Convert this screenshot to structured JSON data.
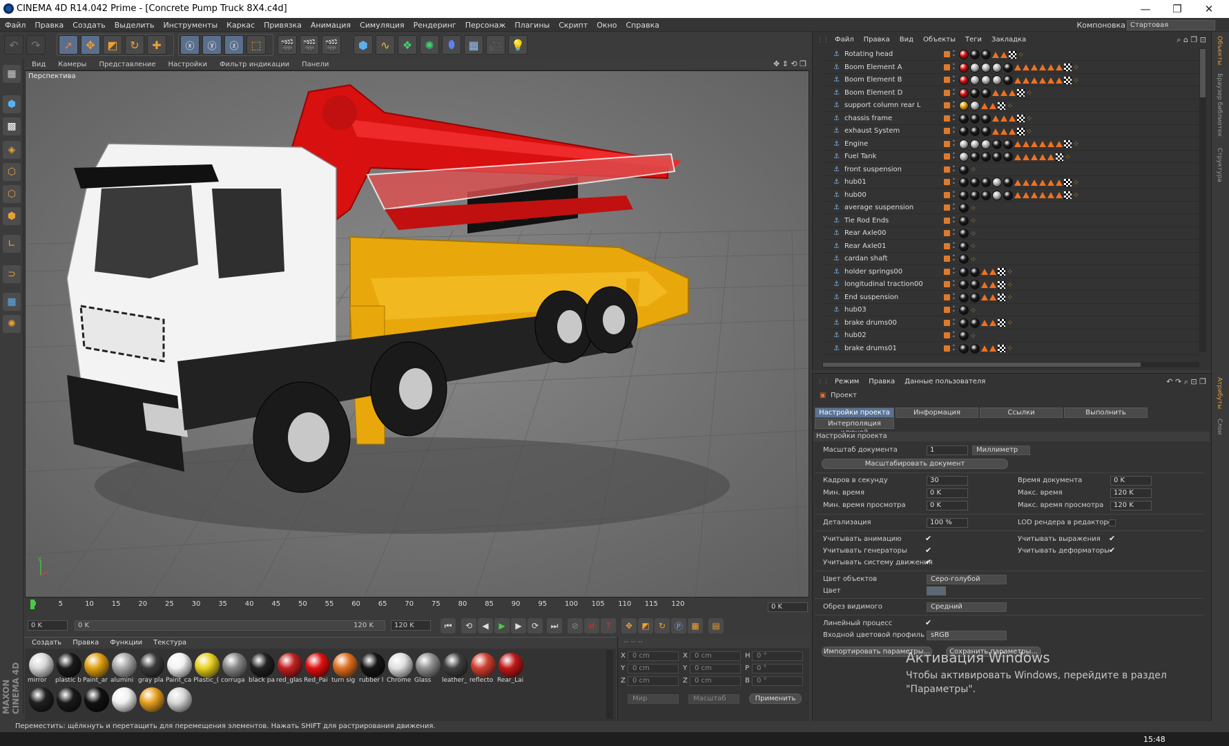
{
  "window": {
    "title": "CINEMA 4D R14.042 Prime - [Concrete Pump Truck 8X4.c4d]"
  },
  "menu": [
    "Файл",
    "Правка",
    "Создать",
    "Выделить",
    "Инструменты",
    "Каркас",
    "Привязка",
    "Анимация",
    "Симуляция",
    "Рендеринг",
    "Персонаж",
    "Плагины",
    "Скрипт",
    "Окно",
    "Справка"
  ],
  "layout": {
    "label": "Компоновка",
    "value": "Стартовая"
  },
  "viewport": {
    "menu": [
      "Вид",
      "Камеры",
      "Представление",
      "Настройки",
      "Фильтр индикации",
      "Панели"
    ],
    "label": "Перспектива"
  },
  "timeline": {
    "ticks": [
      "0",
      "5",
      "10",
      "15",
      "20",
      "25",
      "30",
      "35",
      "40",
      "45",
      "50",
      "55",
      "60",
      "65",
      "70",
      "75",
      "80",
      "85",
      "90",
      "95",
      "100",
      "105",
      "110",
      "115",
      "120"
    ],
    "current_frame": "0 K"
  },
  "playbar": {
    "start": "0 K",
    "range_start": "0 K",
    "range_end": "120 K",
    "end": "120 K"
  },
  "materials": {
    "menu": [
      "Создать",
      "Правка",
      "Функции",
      "Текстура"
    ],
    "items": [
      {
        "label": "mirror",
        "color": "#d8d8d8"
      },
      {
        "label": "plastic b",
        "color": "#1a1a1a"
      },
      {
        "label": "Paint_ar",
        "color": "#e0a010"
      },
      {
        "label": "alumini",
        "color": "#a8a8a8"
      },
      {
        "label": "gray pla",
        "color": "#3a3a3a"
      },
      {
        "label": "Paint_ca",
        "color": "#f2f2f2"
      },
      {
        "label": "Plastic_(",
        "color": "#e8d020"
      },
      {
        "label": "corruga",
        "color": "#888888"
      },
      {
        "label": "black pa",
        "color": "#202020"
      },
      {
        "label": "red_glas",
        "color": "#c02020"
      },
      {
        "label": "Red_Pai",
        "color": "#e01010"
      },
      {
        "label": "turn sig",
        "color": "#e07020"
      },
      {
        "label": "rubber l",
        "color": "#151515"
      },
      {
        "label": "Chrome",
        "color": "#e0e0e0"
      },
      {
        "label": "Glass",
        "color": "#909090"
      },
      {
        "label": "leather_",
        "color": "#404040"
      },
      {
        "label": "reflecto",
        "color": "#d04030"
      },
      {
        "label": "Rear_Lai",
        "color": "#c01818"
      }
    ],
    "row2": [
      {
        "color": "#202020"
      },
      {
        "color": "#1a1a1a"
      },
      {
        "color": "#111111"
      },
      {
        "color": "#f0f0f0"
      },
      {
        "color": "#e8a020"
      },
      {
        "color": "#d8d8d8"
      }
    ]
  },
  "coords": {
    "x1": "0 cm",
    "y1": "0 cm",
    "z1": "0 cm",
    "x2": "0 cm",
    "y2": "0 cm",
    "z2": "0 cm",
    "h": "0 °",
    "p": "0 °",
    "b": "0 °",
    "mode1": "Мир",
    "mode2": "Масштаб",
    "apply": "Применить"
  },
  "status": "Переместить: щёлкнуть и перетащить для перемещения элементов. Нажать SHIFT для растрирования движения.",
  "objects": {
    "menu": [
      "Файл",
      "Правка",
      "Вид",
      "Объекты",
      "Теги",
      "Закладка"
    ],
    "rows": [
      {
        "name": "Rotating head",
        "tags": "rbbTTcs"
      },
      {
        "name": "Boom Element A",
        "tags": "rgggbTTTTTTcs"
      },
      {
        "name": "Boom Element B",
        "tags": "rgggbTTTTTTcs"
      },
      {
        "name": "Boom Element D",
        "tags": "rbbTTTcs"
      },
      {
        "name": "support column rear L",
        "tags": "ygTTcs"
      },
      {
        "name": "chassis frame",
        "tags": "bbbTTTcs"
      },
      {
        "name": "exhaust System",
        "tags": "bbbTTTcs"
      },
      {
        "name": "Engine",
        "tags": "gggbbTTTTTTcs"
      },
      {
        "name": "Fuel Tank",
        "tags": "gbbbbTTTTTcs"
      },
      {
        "name": "front suspension",
        "tags": "bs"
      },
      {
        "name": "hub01",
        "tags": "bbbgbTTTTTTcs"
      },
      {
        "name": "hub00",
        "tags": "bbbgbTTTTTTcs"
      },
      {
        "name": "average suspension",
        "tags": "bs"
      },
      {
        "name": "Tie Rod Ends",
        "tags": "bs"
      },
      {
        "name": "Rear Axle00",
        "tags": "bs"
      },
      {
        "name": "Rear Axle01",
        "tags": "bs"
      },
      {
        "name": "cardan shaft",
        "tags": "bs"
      },
      {
        "name": "holder springs00",
        "tags": "bbTTcs"
      },
      {
        "name": "longitudinal traction00",
        "tags": "bbTTcs"
      },
      {
        "name": "End suspension",
        "tags": "bbTTcs"
      },
      {
        "name": "hub03",
        "tags": "bs"
      },
      {
        "name": "brake drums00",
        "tags": "bbTTcs"
      },
      {
        "name": "hub02",
        "tags": "bs"
      },
      {
        "name": "brake drums01",
        "tags": "bbTTcs"
      }
    ]
  },
  "attributes": {
    "menu": [
      "Режим",
      "Правка",
      "Данные пользователя"
    ],
    "title": "Проект",
    "tabs": [
      "Настройки проекта",
      "Информация",
      "Ссылки",
      "Выполнить"
    ],
    "tab2": "Интерполяция ключей",
    "section": "Настройки проекта",
    "doc_scale_label": "Масштаб документа",
    "doc_scale_value": "1",
    "doc_scale_unit": "Миллиметр",
    "scale_btn": "Масштабировать документ",
    "fps_label": "Кадров в секунду",
    "fps": "30",
    "doc_time_label": "Время документа",
    "doc_time": "0 K",
    "min_time_label": "Мин. время",
    "min_time": "0 K",
    "max_time_label": "Макс. время",
    "max_time": "120 K",
    "min_prev_label": "Мин. время просмотра",
    "min_prev": "0 K",
    "max_prev_label": "Макс. время просмотра",
    "max_prev": "120 K",
    "detail_label": "Детализация",
    "detail": "100 %",
    "lod_label": "LOD рендера в редакторе",
    "anim_label": "Учитывать анимацию",
    "expr_label": "Учитывать выражения",
    "gen_label": "Учитывать генераторы",
    "deform_label": "Учитывать деформаторы",
    "motion_label": "Учитывать систему движения",
    "objcolor_label": "Цвет объектов",
    "objcolor": "Серо-голубой",
    "color_label": "Цвет",
    "clip_label": "Обрез видимого",
    "clip": "Средний",
    "linear_label": "Линейный процесс",
    "profile_label": "Входной цветовой профиль",
    "profile": "sRGB",
    "import_btn": "Импортировать параметры...",
    "save_btn": "Сохранить параметры..."
  },
  "side_tabs": [
    "Объекты",
    "Браузер библиотек",
    "Структура",
    "Атрибуты",
    "Слои"
  ],
  "watermark": {
    "title": "Активация Windows",
    "line1": "Чтобы активировать Windows, перейдите в раздел",
    "line2": "\"Параметры\"."
  },
  "clock": "15:48",
  "colors": {
    "accent": "#5a7396",
    "boom_red": "#d81010",
    "body_yellow": "#e8a80c"
  }
}
